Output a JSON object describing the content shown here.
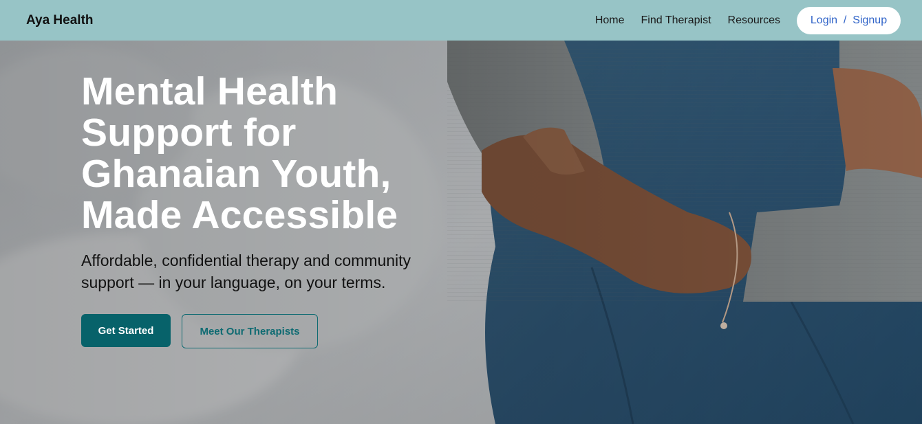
{
  "brand": {
    "name": "Aya Health"
  },
  "nav": {
    "links": [
      "Home",
      "Find Therapist",
      "Resources"
    ],
    "auth_label": "Login  /  Signup"
  },
  "hero": {
    "title_lines": [
      "Mental Health",
      "Support for",
      "Ghanaian Youth,",
      "Made Accessible"
    ],
    "subtitle": "Affordable, confidential therapy and community support — in your language, on your terms.",
    "primary_button": "Get Started",
    "secondary_button": "Meet Our Therapists",
    "background_image": "person-hugging-knees-photo"
  },
  "colors": {
    "navbar": "#97c4c6",
    "primary": "#07626a",
    "link": "#2f63c8"
  }
}
